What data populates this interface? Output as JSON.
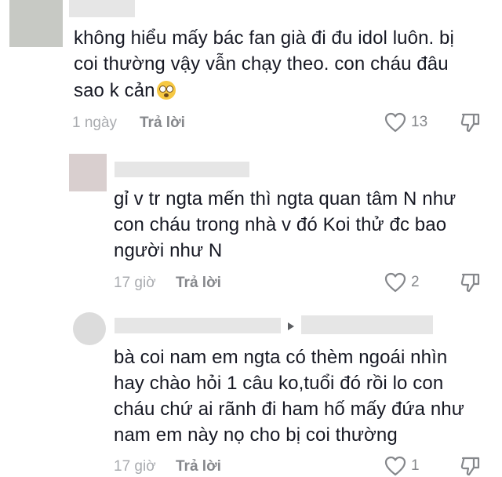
{
  "comments": [
    {
      "text": "không hiểu mấy bác fan già đi đu idol luôn. bị coi thường vậy vẫn chạy theo. con cháu đâu sao k cản",
      "line1": "không hiểu mấy bác fan già đi đu idol luôn. bị",
      "line2": "coi thường vậy vẫn chạy theo. con cháu đâu",
      "line3": "sao k cản",
      "emoji": "flushed-face",
      "time": "1 ngày",
      "reply_label": "Trả lời",
      "likes": "13"
    },
    {
      "line1": "gỉ v tr ngta mến thì ngta quan tâm N như",
      "line2": "con cháu trong nhà v đó Koi thử đc bao",
      "line3": "người như N",
      "time": "17 giờ",
      "reply_label": "Trả lời",
      "likes": "2"
    },
    {
      "line1": "bà coi nam em ngta có thèm ngoái nhìn",
      "line2": "hay chào hỏi 1 câu ko,tuổi đó rồi lo con",
      "line3": "cháu chứ ai rãnh đi ham hố mấy đứa như",
      "line4": "nam em này nọ cho bị coi thường",
      "time": "17 giờ",
      "reply_label": "Trả lời",
      "likes": "1"
    }
  ],
  "icons": {
    "like": "heart-outline-icon",
    "dislike": "thumbs-down-icon",
    "reply_arrow": "triangle-right-icon"
  },
  "colors": {
    "text": "#161823",
    "meta": "#a9abaf",
    "action": "#85878b"
  }
}
